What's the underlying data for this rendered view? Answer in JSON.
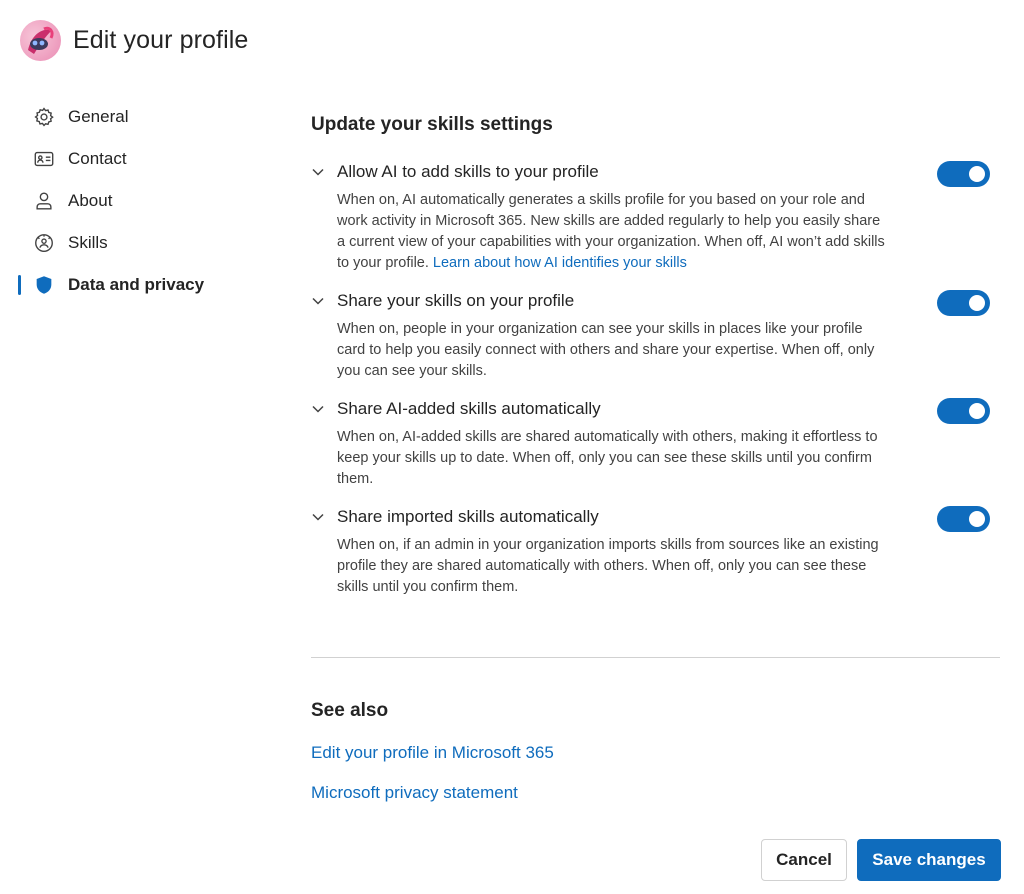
{
  "header": {
    "title": "Edit your profile",
    "avatar_icon": "user-avatar"
  },
  "sidebar": {
    "items": [
      {
        "label": "General",
        "icon": "gear-icon"
      },
      {
        "label": "Contact",
        "icon": "contact-card-icon"
      },
      {
        "label": "About",
        "icon": "person-icon"
      },
      {
        "label": "Skills",
        "icon": "skills-icon"
      },
      {
        "label": "Data and privacy",
        "icon": "shield-icon",
        "active": true
      }
    ]
  },
  "main": {
    "section_title": "Update your skills settings",
    "settings": [
      {
        "title": "Allow AI to add skills to your profile",
        "description": "When on, AI automatically generates a skills profile for you based on your role and work activity in Microsoft 365. New skills are added regularly to help you easily share a current view of your capabilities with your organization. When off, AI won’t add skills to your profile.",
        "link": "Learn about how AI identifies your skills",
        "enabled": true
      },
      {
        "title": "Share your skills on your profile",
        "description": "When on, people in your organization can see your skills in places like your profile card to help you easily connect with others and share your expertise. When off, only you can see your skills.",
        "enabled": true
      },
      {
        "title": "Share AI-added skills automatically",
        "description": "When on, AI-added skills are shared automatically with others, making it effortless to keep your skills up to date. When off, only you can see these skills until you confirm them.",
        "enabled": true
      },
      {
        "title": "Share imported skills automatically",
        "description": "When on, if an admin in your organization imports skills from sources like an existing profile they are shared automatically with others. When off, only you can see these skills until you confirm them.",
        "enabled": true
      }
    ]
  },
  "see_also": {
    "title": "See also",
    "links": [
      "Edit your profile in Microsoft 365",
      "Microsoft privacy statement"
    ]
  },
  "footer": {
    "cancel_label": "Cancel",
    "save_label": "Save changes"
  },
  "colors": {
    "accent": "#0f6cbd",
    "text": "#242424",
    "muted": "#424242",
    "divider": "#d1d1d1"
  }
}
